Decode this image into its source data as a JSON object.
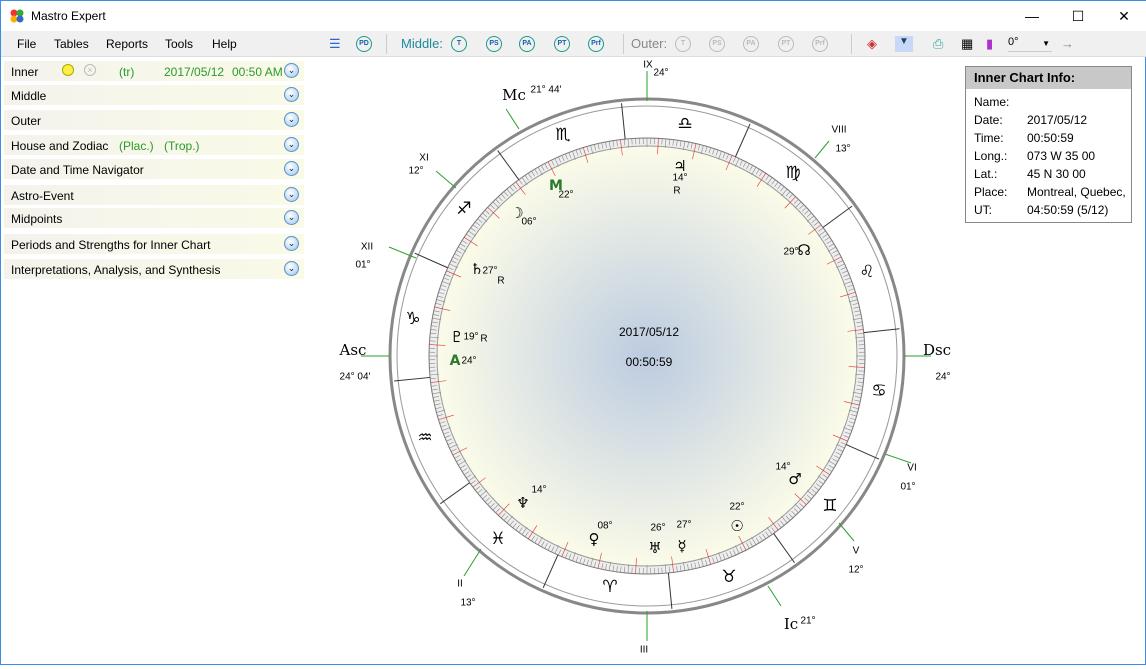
{
  "window": {
    "title": "Mastro Expert",
    "minimize": "—",
    "maximize": "☐",
    "close": "✕"
  },
  "menu": [
    "File",
    "Tables",
    "Reports",
    "Tools",
    "Help"
  ],
  "toolbar": {
    "middle_label": "Middle:",
    "outer_label": "Outer:",
    "buttons": [
      "T",
      "PS",
      "PA",
      "PT",
      "Prf"
    ],
    "pd": "PD",
    "rotation": "0°",
    "arrow": "→"
  },
  "panels": [
    {
      "label": "Inner",
      "extra": [
        "(tr)",
        "2017/05/12",
        "00:50 AM"
      ]
    },
    {
      "label": "Middle"
    },
    {
      "label": "Outer"
    },
    {
      "label": "House and Zodiac",
      "extra": [
        "(Plac.)",
        "(Trop.)"
      ]
    },
    {
      "label": "Date and Time Navigator"
    },
    {
      "label": "Astro-Event"
    },
    {
      "label": "Midpoints"
    },
    {
      "label": "Periods and Strengths for Inner Chart"
    },
    {
      "label": "Interpretations, Analysis, and Synthesis"
    }
  ],
  "info": {
    "title": "Inner Chart Info:",
    "rows": [
      [
        "Name:",
        ""
      ],
      [
        "Date:",
        "2017/05/12"
      ],
      [
        "Time:",
        "00:50:59"
      ],
      [
        "Long.:",
        "073 W 35 00"
      ],
      [
        "Lat.:",
        "45 N 30 00"
      ],
      [
        "Place:",
        "Montreal, Quebec,"
      ],
      [
        "UT:",
        "04:50:59 (5/12)"
      ]
    ]
  },
  "chart": {
    "center_date": "2017/05/12",
    "center_time": "00:50:59",
    "signs": [
      "♎",
      "♍",
      "♌",
      "♋",
      "♊",
      "♉",
      "♈",
      "♓",
      "♒",
      "♑",
      "♐",
      "♏"
    ],
    "angles": [
      {
        "name": "Mc",
        "deg": "21° 44'"
      },
      {
        "name": "Asc",
        "deg": "24° 04'"
      },
      {
        "name": "Dsc",
        "deg": "24°"
      },
      {
        "name": "Ic",
        "deg": "21°"
      }
    ],
    "houses": [
      {
        "name": "IX",
        "deg": "24°"
      },
      {
        "name": "VIII",
        "deg": "13°"
      },
      {
        "name": "XI",
        "deg": "12°"
      },
      {
        "name": "XII",
        "deg": "01°"
      },
      {
        "name": "VI",
        "deg": "01°"
      },
      {
        "name": "V",
        "deg": "12°"
      },
      {
        "name": "II",
        "deg": "13°"
      },
      {
        "name": "III",
        "deg": ""
      }
    ],
    "planets": [
      {
        "glyph": "♃",
        "deg": "14°",
        "retro": "R"
      },
      {
        "glyph": "M",
        "deg": "22°",
        "retro": ""
      },
      {
        "glyph": "☽",
        "deg": "06°",
        "retro": ""
      },
      {
        "glyph": "♄",
        "deg": "27°",
        "retro": "R"
      },
      {
        "glyph": "♇",
        "deg": "19°",
        "retro": "R"
      },
      {
        "glyph": "A",
        "deg": "24°",
        "retro": ""
      },
      {
        "glyph": "♆",
        "deg": "14°",
        "retro": ""
      },
      {
        "glyph": "♀",
        "deg": "08°",
        "retro": ""
      },
      {
        "glyph": "♅",
        "deg": "26°",
        "retro": ""
      },
      {
        "glyph": "☿",
        "deg": "27°",
        "retro": ""
      },
      {
        "glyph": "☉",
        "deg": "22°",
        "retro": ""
      },
      {
        "glyph": "♂",
        "deg": "14°",
        "retro": ""
      },
      {
        "glyph": "☊",
        "deg": "29°",
        "retro": ""
      }
    ]
  },
  "colors": {
    "cusp": "#2aa02a",
    "tick_red": "#e03030",
    "accent_green": "#2a9a2a"
  }
}
